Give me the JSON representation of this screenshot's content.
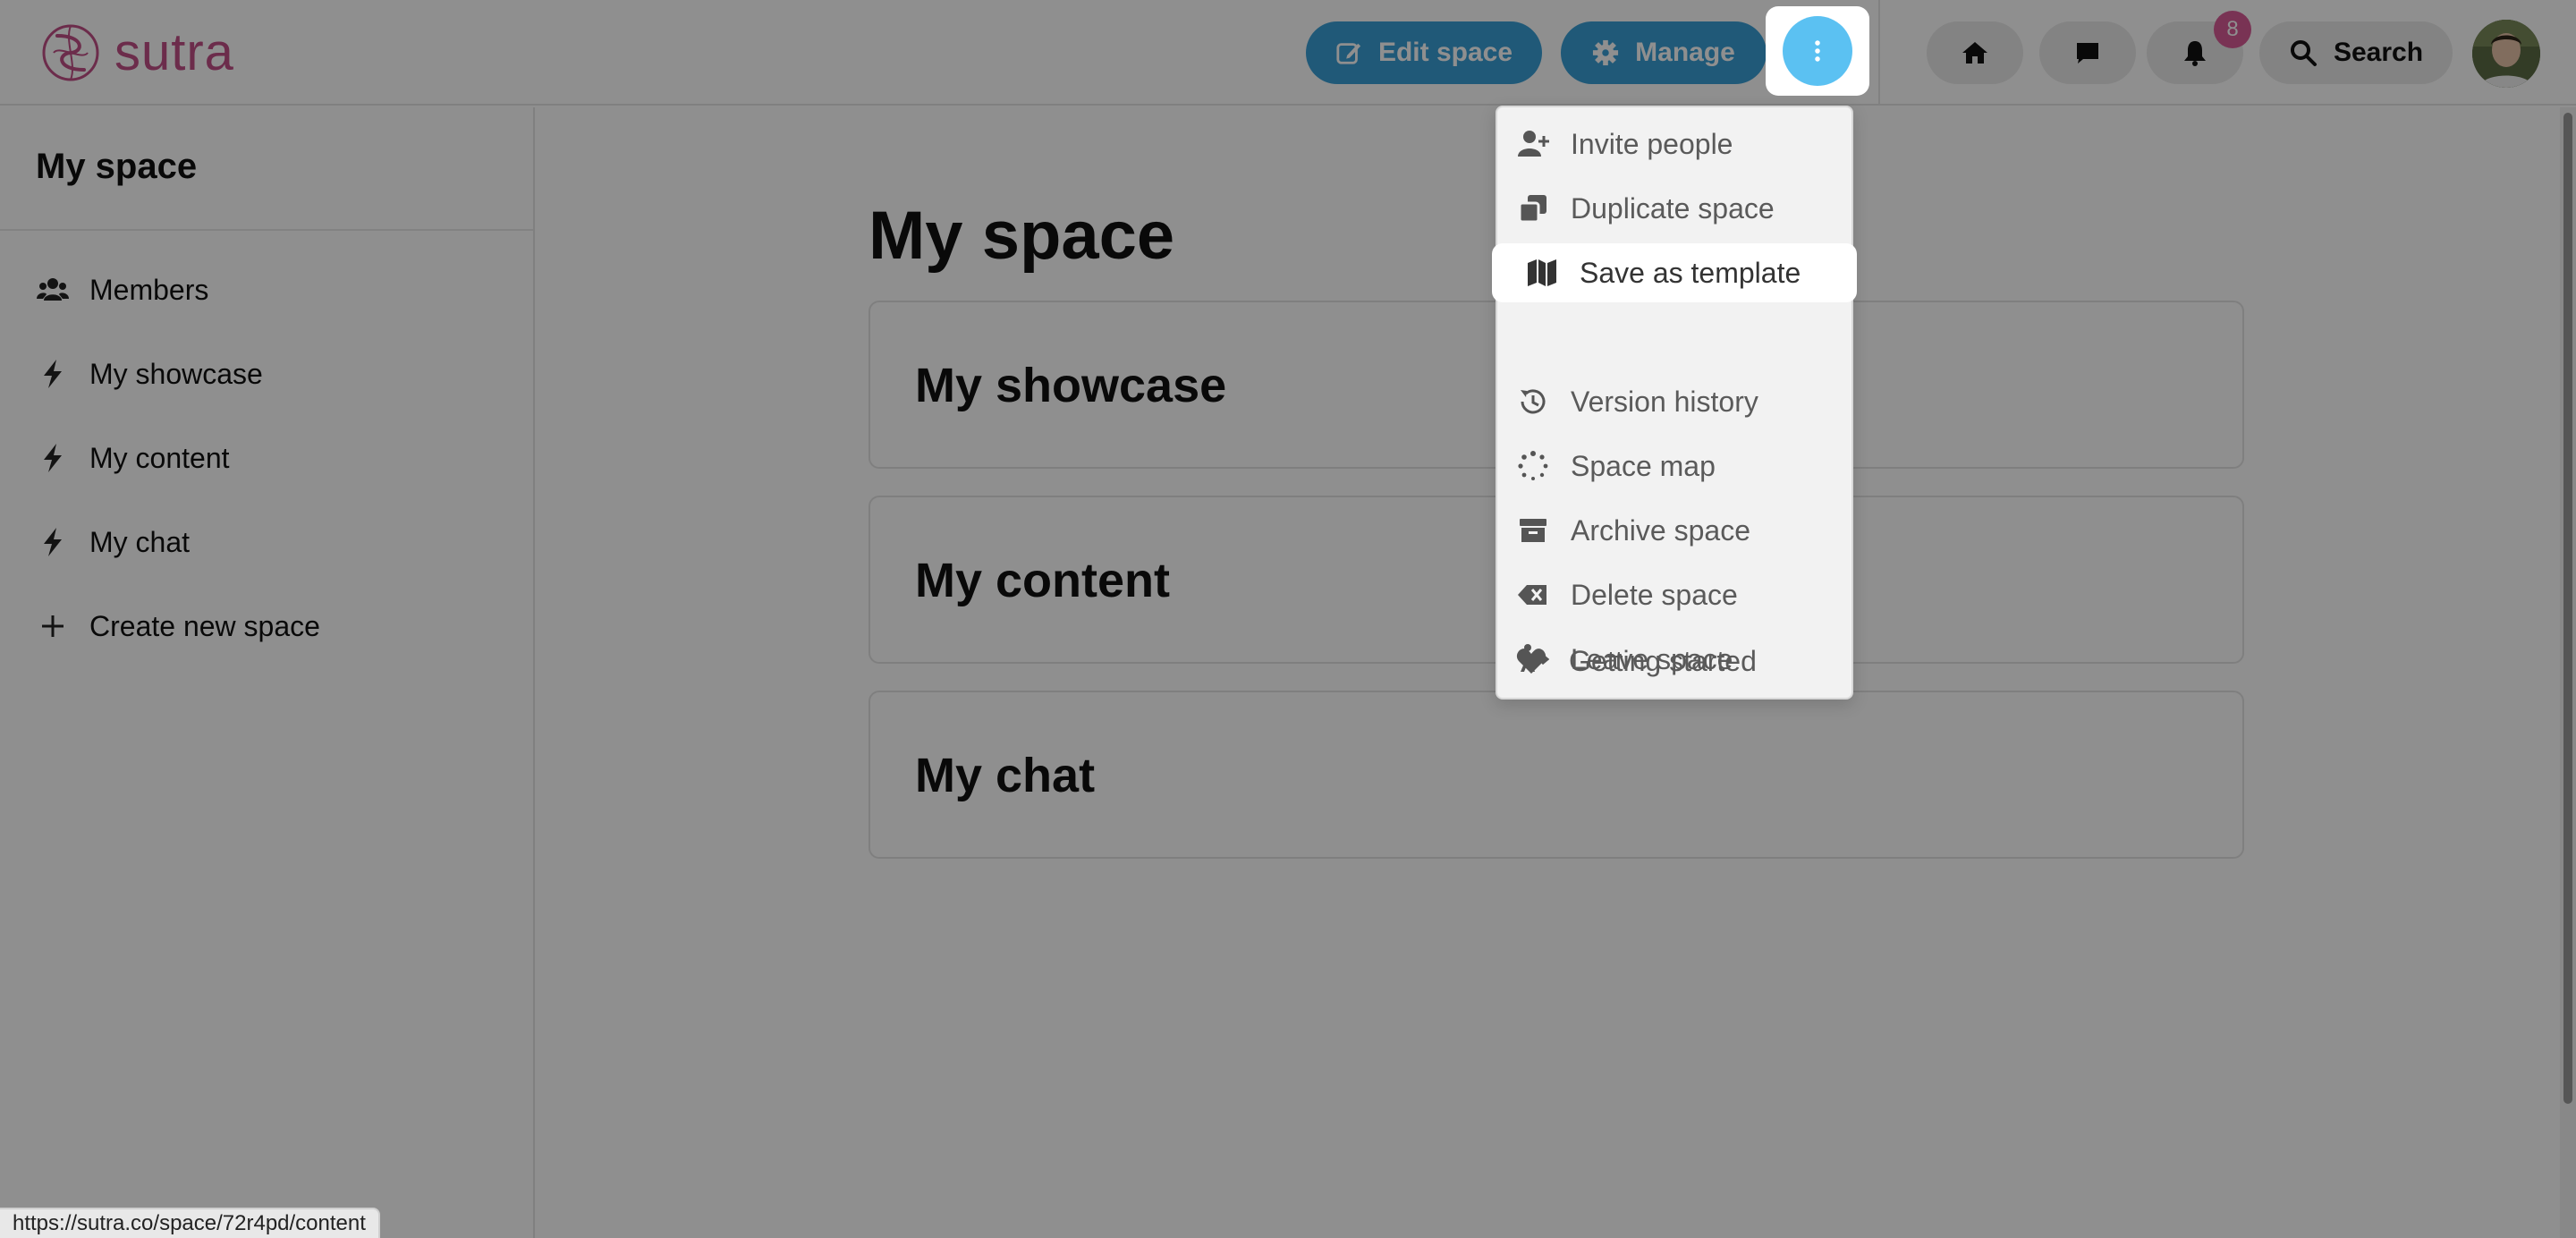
{
  "app": {
    "logo_text": "sutra",
    "brand_color": "#c04f86",
    "accent_color": "#3a9fd6"
  },
  "header": {
    "edit_label": "Edit space",
    "edit_icon": "edit-icon",
    "manage_label": "Manage",
    "manage_icon": "gear-icon",
    "more_icon": "more-vertical-icon",
    "home_icon": "home-icon",
    "chat_icon": "chat-icon",
    "bell_icon": "bell-icon",
    "notification_count": "8",
    "search_label": "Search",
    "search_icon": "search-icon"
  },
  "sidebar": {
    "title": "My space",
    "items": [
      {
        "label": "Members",
        "icon": "users-icon"
      },
      {
        "label": "My showcase",
        "icon": "bolt-icon"
      },
      {
        "label": "My content",
        "icon": "bolt-icon"
      },
      {
        "label": "My chat",
        "icon": "bolt-icon"
      },
      {
        "label": "Create new space",
        "icon": "plus-icon"
      }
    ]
  },
  "main": {
    "title": "My space",
    "cards": [
      {
        "title": "My showcase"
      },
      {
        "title": "My content"
      },
      {
        "title": "My chat"
      }
    ]
  },
  "menu": {
    "items": [
      {
        "label": "Invite people",
        "icon": "user-plus-icon"
      },
      {
        "label": "Duplicate space",
        "icon": "copy-icon"
      },
      {
        "label": "Save as template",
        "icon": "map-icon",
        "highlighted": true
      },
      {
        "label": "Version history",
        "icon": "history-icon"
      },
      {
        "label": "Space map",
        "icon": "spinner-dots-icon"
      },
      {
        "label": "Archive space",
        "icon": "archive-icon"
      },
      {
        "label": "Delete space",
        "icon": "delete-backspace-icon"
      },
      {
        "label": "Leave space",
        "icon": "person-walking-arrow-icon"
      },
      {
        "label": "Getting started",
        "icon": "heart-icon"
      }
    ]
  },
  "status": {
    "url": "https://sutra.co/space/72r4pd/content"
  }
}
